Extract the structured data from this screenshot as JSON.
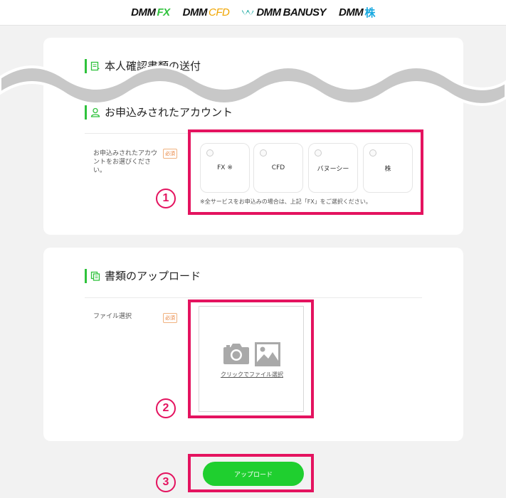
{
  "header": {
    "brands": [
      {
        "prefix": "DMM",
        "suffix": "FX"
      },
      {
        "prefix": "DMM",
        "suffix": "CFD"
      },
      {
        "prefix": "DMM",
        "suffix": "BANUSY"
      },
      {
        "prefix": "DMM",
        "suffix": "株"
      }
    ]
  },
  "identity_section": {
    "title": "本人確認書類の送付"
  },
  "account_section": {
    "title": "お申込みされたアカウント",
    "field_label": "お申込みされたアカウントをお選びください。",
    "required_label": "必須",
    "options": [
      {
        "label": "FX ※"
      },
      {
        "label": "CFD"
      },
      {
        "label": "バヌーシー"
      },
      {
        "label": "株"
      }
    ],
    "note": "※全サービスをお申込みの場合は、上記「FX」をご選択ください。"
  },
  "upload_section": {
    "title": "書類のアップロード",
    "field_label": "ファイル選択",
    "required_label": "必須",
    "link_text": "クリックでファイル選択"
  },
  "submit": {
    "label": "アップロード"
  },
  "markers": [
    "1",
    "2",
    "3"
  ],
  "colors": {
    "accent_green": "#2fc23c",
    "button_green": "#1fcf2f",
    "highlight": "#e4135f",
    "required_orange": "#e8813a"
  }
}
